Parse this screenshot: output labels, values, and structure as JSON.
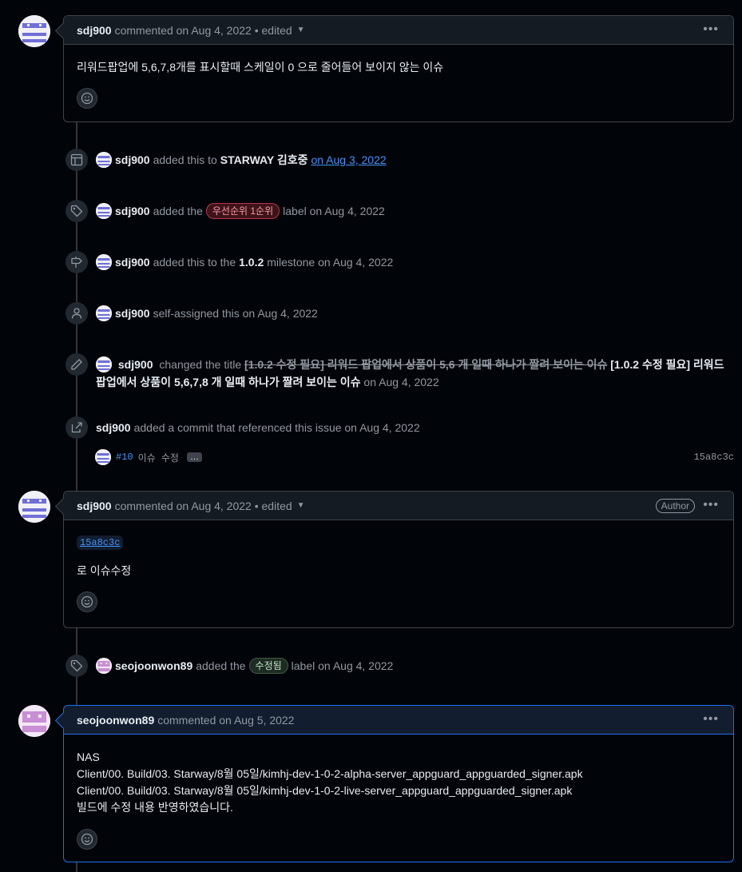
{
  "comment1": {
    "author": "sdj900",
    "meta": "commented on Aug 4, 2022 • edited",
    "body": "리워드팝업에 5,6,7,8개를 표시할때 스케일이 0 으로 줄어들어 보이지 않는 이슈"
  },
  "events": {
    "project": {
      "actor": "sdj900",
      "text1": "added this to",
      "project": "STARWAY 김호중",
      "date_link": "on Aug 3, 2022"
    },
    "label1": {
      "actor": "sdj900",
      "text1": "added the",
      "label": "우선순위 1순위",
      "text2": "label on Aug 4, 2022"
    },
    "milestone": {
      "actor": "sdj900",
      "text1": "added this to the",
      "milestone": "1.0.2",
      "text2": "milestone on Aug 4, 2022"
    },
    "assign": {
      "actor": "sdj900",
      "text1": "self-assigned this on Aug 4, 2022"
    },
    "rename": {
      "actor": "sdj900",
      "text1": "changed the title",
      "old_title": "[1.0.2 수정 필요] 리워드 팝업에서 상품이 5,6 개 일때 하나가 짤려 보이는 이슈",
      "new_title": "[1.0.2 수정 필요] 리워드 팝업에서 상품이 5,6,7,8 개 일때 하나가 짤려 보이는 이슈",
      "text2": "on Aug 4, 2022"
    },
    "commit_ref": {
      "actor": "sdj900",
      "text1": "added a commit that referenced this issue on Aug 4, 2022",
      "commit_pr": "#10",
      "commit_msg": "이슈 수정",
      "commit_more": "…",
      "commit_sha": "15a8c3c"
    },
    "label2": {
      "actor": "seojoonwon89",
      "text1": "added the",
      "label": "수정됨",
      "text2": "label on Aug 4, 2022"
    }
  },
  "comment2": {
    "author": "sdj900",
    "meta": "commented on Aug 4, 2022 • edited",
    "badge": "Author",
    "sha": "15a8c3c",
    "body": "로 이슈수정"
  },
  "comment3": {
    "author": "seojoonwon89",
    "meta": "commented on Aug 5, 2022",
    "lines": [
      "NAS",
      "Client/00. Build/03. Starway/8월 05일/kimhj-dev-1-0-2-alpha-server_appguard_appguarded_signer.apk",
      "Client/00. Build/03. Starway/8월 05일/kimhj-dev-1-0-2-live-server_appguard_appguarded_signer.apk",
      "빌드에 수정 내용 반영하였습니다."
    ]
  },
  "colors": {
    "accent": "#4493f8",
    "label_priority_bg": "#3d1419",
    "label_priority_fg": "#ff9ba8",
    "label_priority_border": "#b9354a",
    "label_fixed_bg": "#1e2b22",
    "label_fixed_fg": "#c3e6c8"
  }
}
